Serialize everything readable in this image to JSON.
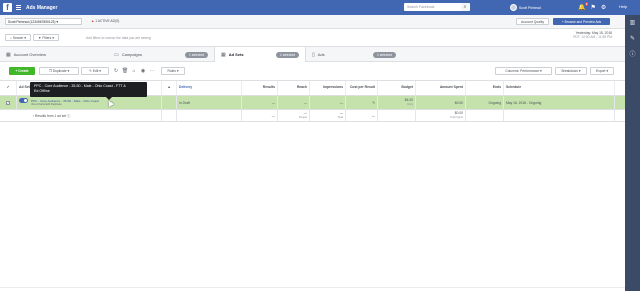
{
  "topbar": {
    "app_title": "Ads Manager",
    "search_placeholder": "Search Facebook",
    "user_name": "Scott Pinhead",
    "notification_count": "2",
    "help_label": "Help"
  },
  "account_bar": {
    "account_name": "Scott Pinhead (1234567890123)",
    "warning_text": "1 ACTIVE AD(S)",
    "account_button": "Account Quality",
    "create_button": "+ Browse and Preview Ads"
  },
  "filter_bar": {
    "search_label": "Search",
    "filters_label": "Filters",
    "filter_placeholder": "Add filters to narrow the data you are seeing",
    "date_line1": "Yesterday: May 15, 2018",
    "date_line2": "PDT: 12:00 AM - 11:59 PM"
  },
  "tabs": [
    {
      "label": "Account Overview",
      "icon": "grid",
      "pill": ""
    },
    {
      "label": "Campaigns",
      "icon": "folder",
      "pill": "1 selected"
    },
    {
      "label": "Ad Sets",
      "icon": "grid",
      "pill": "1 selected"
    },
    {
      "label": "Ads",
      "icon": "doc",
      "pill": "1 selected"
    }
  ],
  "toolbar": {
    "create_label": "+ Create",
    "duplicate_label": "Duplicate",
    "edit_label": "Edit",
    "rules_label": "Rules",
    "columns_label": "Columns: Performance",
    "breakdown_label": "Breakdown",
    "export_label": "Export"
  },
  "table": {
    "headers": {
      "name": "Ad Set Name",
      "delivery": "Delivery",
      "results": "Results",
      "reach": "Reach",
      "impressions": "Impressions",
      "cost_per_result": "Cost per Result",
      "budget": "Budget",
      "amount_spent": "Amount Spent",
      "ends": "Ends",
      "schedule": "Schedule"
    },
    "row": {
      "name": "PPC - Core Audience - 35-50 - Male - Ohio Coast",
      "sub": "View Charts  Edit  Duplicate",
      "delivery": "In Draft",
      "results": "—",
      "reach": "—",
      "impressions": "—",
      "cost_per_result": "—",
      "budget": "$4.00",
      "budget_sub": "Daily",
      "amount_spent": "$0.00",
      "ends": "Ongoing",
      "schedule": "May 16, 2018 - Ongoing"
    },
    "summary": {
      "label": "Results from 1 ad set",
      "results": "—",
      "reach": "—",
      "reach_sub": "People",
      "impressions": "—",
      "impressions_sub": "Total",
      "cost_per_result": "—",
      "amount_spent": "$0.00",
      "amount_spent_sub": "Total Spent"
    }
  },
  "tooltip": {
    "line1": "PPC - Core Audience - 35-50 - Male - Ohio Coast - FTT &",
    "line2": "Ed Offline"
  },
  "colors": {
    "brand_blue": "#4267b2",
    "create_green": "#42b72a",
    "selected_row": "#c5e2ad"
  }
}
